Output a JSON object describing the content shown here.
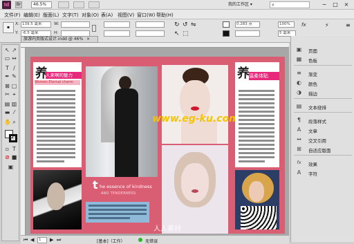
{
  "titlebar": {
    "app_badge": "Id",
    "zoom": "46.5%",
    "workspace": "我的工作区",
    "search_placeholder": "",
    "window_controls": [
      "−",
      "□",
      "×"
    ]
  },
  "menu": [
    "文件(F)",
    "编辑(E)",
    "版面(L)",
    "文字(T)",
    "对象(O)",
    "表(A)",
    "视图(V)",
    "窗口(W)",
    "帮助(H)"
  ],
  "control": {
    "x_value": "139.5 毫米",
    "y_value": "-6.5 毫米",
    "w_label": "W:",
    "h_label": "H:",
    "stroke_weight": "0.283 点",
    "opacity": "100%",
    "value_5mm": "5 毫米",
    "zoom_100": "100%"
  },
  "document": {
    "tab_title": "旅游内页版式设计.indd @ 46%",
    "left_title": "人来啊的魅力",
    "left_char": "养",
    "left_subtitle": "Women Eternal charm",
    "right_title": "温柔体贴",
    "right_char": "养",
    "center_slogan_big": "t",
    "center_slogan": "he essence of kindness",
    "center_slogan2": "AND TENDERNESS",
    "watermark": "www.eg-ku.com",
    "watermark_bottom": "人人素材"
  },
  "panel": {
    "items": [
      {
        "icon": "pages-icon",
        "glyph": "▣",
        "label": "页面"
      },
      {
        "icon": "swatches-icon",
        "glyph": "▦",
        "label": "色板"
      },
      {
        "icon": "stroke-icon",
        "glyph": "≡",
        "label": "渐变"
      },
      {
        "icon": "color-icon",
        "glyph": "◐",
        "label": "颜色"
      },
      {
        "icon": "effects-icon",
        "glyph": "◑",
        "label": "描边"
      },
      {
        "icon": "text-wrap-icon",
        "glyph": "▤",
        "label": "文本绕排"
      },
      {
        "icon": "paragraph-style-icon",
        "glyph": "¶",
        "label": "段落样式"
      },
      {
        "icon": "character-icon",
        "glyph": "A",
        "label": "文章"
      },
      {
        "icon": "cross-ref-icon",
        "glyph": "↔",
        "label": "交叉引用"
      },
      {
        "icon": "table-icon",
        "glyph": "⊞",
        "label": "自适应版面"
      },
      {
        "icon": "fx-icon",
        "glyph": "fx",
        "label": "效果"
      },
      {
        "icon": "glyph-icon",
        "glyph": "A",
        "label": "字符"
      }
    ]
  },
  "status": {
    "page": "1",
    "mode": "[基本]（工作）",
    "errors": "无错误"
  },
  "colors": {
    "page_pink": "#d95e74",
    "accent_pink": "#e8287a",
    "blue_bar": "#8fb9d8"
  }
}
